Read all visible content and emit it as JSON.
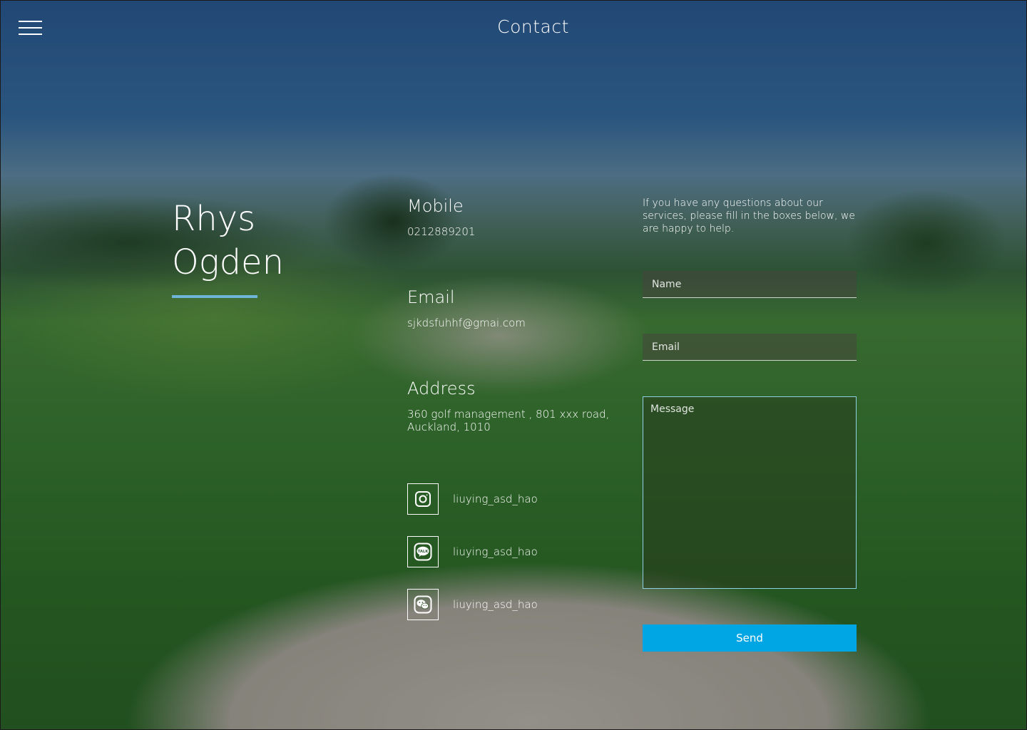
{
  "header": {
    "title": "Contact",
    "menu_icon": "hamburger-menu-icon"
  },
  "person": {
    "first_name": "Rhys",
    "last_name": "Ogden"
  },
  "contact": {
    "mobile_label": "Mobile",
    "mobile_value": "0212889201",
    "email_label": "Email",
    "email_value": "sjkdsfuhhf@gmai.com",
    "address_label": "Address",
    "address_value": "360 golf management ,  801 xxx road, Auckland, 1010"
  },
  "social": [
    {
      "icon": "instagram-icon",
      "handle": "liuying_asd_hao"
    },
    {
      "icon": "kakaotalk-icon",
      "handle": "liuying_asd_hao"
    },
    {
      "icon": "wechat-icon",
      "handle": "liuying_asd_hao"
    }
  ],
  "form": {
    "intro": "If you have any questions about our services, please fill in the boxes below, we are happy to help.",
    "name_placeholder": "Name",
    "email_placeholder": "Email",
    "message_placeholder": "Message",
    "send_label": "Send"
  },
  "colors": {
    "accent_underline": "#6fb5d8",
    "send_button": "#00a6e3",
    "message_border": "#8fd0e6"
  }
}
